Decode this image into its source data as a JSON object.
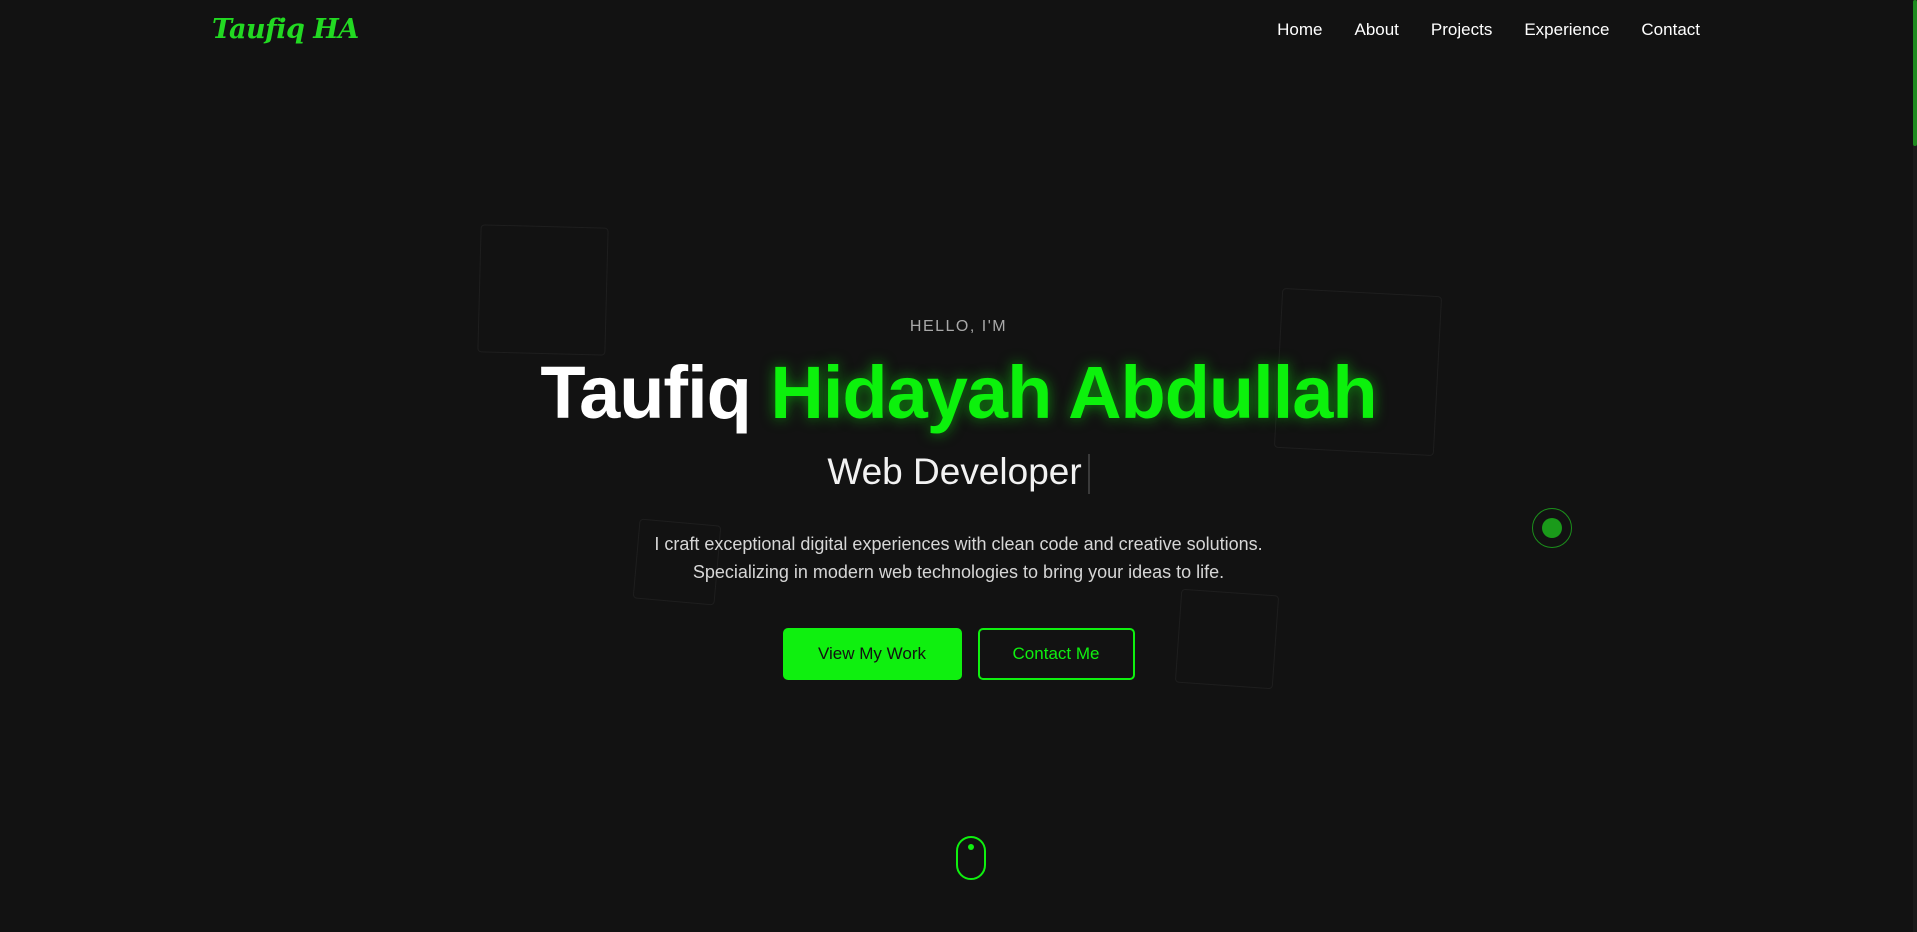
{
  "header": {
    "logo": "Taufiq HA",
    "nav": [
      "Home",
      "About",
      "Projects",
      "Experience",
      "Contact"
    ]
  },
  "hero": {
    "greeting": "HELLO, I'M",
    "name_first": "Taufiq",
    "name_rest": "Hidayah Abdullah",
    "role": "Web Developer",
    "description_line1": "I craft exceptional digital experiences with clean code and creative solutions.",
    "description_line2": "Specializing in modern web technologies to bring your ideas to life.",
    "primary_button": "View My Work",
    "secondary_button": "Contact Me"
  },
  "icons": {
    "scroll_indicator": "mouse-icon",
    "floating_orb": "circle-icon"
  },
  "colors": {
    "accent": "#0ff00f",
    "background": "#121212",
    "text": "#ffffff"
  }
}
